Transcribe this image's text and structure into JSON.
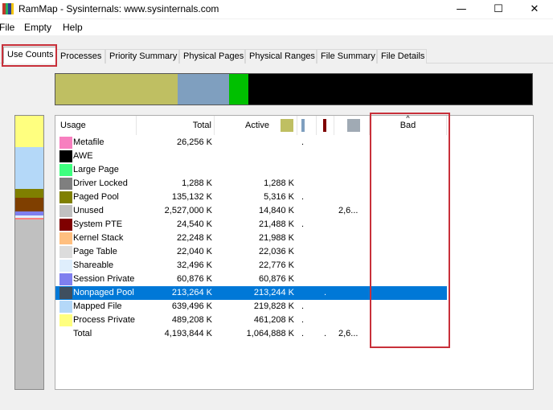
{
  "window": {
    "title": "RamMap - Sysinternals: www.sysinternals.com",
    "minimize": "—",
    "maximize": "☐",
    "close": "✕"
  },
  "menu": {
    "file": "File",
    "empty": "Empty",
    "help": "Help"
  },
  "tabs": {
    "use_counts": "Use Counts",
    "processes": "Processes",
    "priority_summary": "Priority Summary",
    "physical_pages": "Physical Pages",
    "physical_ranges": "Physical Ranges",
    "file_summary": "File Summary",
    "file_details": "File Details"
  },
  "columns": {
    "usage": "Usage",
    "total": "Total",
    "active": "Active",
    "bad": "Bad",
    "sort_indicator": "^"
  },
  "colors": {
    "accent_outline": "#c8303a",
    "selection": "#0078d7",
    "active_swatch": "#bfbf62",
    "standby_swatch": "#7f9fbf",
    "modified_swatch": "#7f0000",
    "transition_swatch": "#a0aab4"
  },
  "rows": [
    {
      "name": "Metafile",
      "total": "26,256 K",
      "active": "",
      "c1": ".",
      "c2": "",
      "c3": "",
      "color": "#f77fbf"
    },
    {
      "name": "AWE",
      "total": "",
      "active": "",
      "c1": "",
      "c2": "",
      "c3": "",
      "color": "#000000"
    },
    {
      "name": "Large Page",
      "total": "",
      "active": "",
      "c1": "",
      "c2": "",
      "c3": "",
      "color": "#3fff7f"
    },
    {
      "name": "Driver Locked",
      "total": "1,288 K",
      "active": "1,288 K",
      "c1": "",
      "c2": "",
      "c3": "",
      "color": "#7f7f7f"
    },
    {
      "name": "Paged Pool",
      "total": "135,132 K",
      "active": "5,316 K",
      "c1": ".",
      "c2": "",
      "c3": "",
      "color": "#7f7f00"
    },
    {
      "name": "Unused",
      "total": "2,527,000 K",
      "active": "14,840 K",
      "c1": "",
      "c2": "",
      "c3": "2,6...",
      "color": "#c0c0c0"
    },
    {
      "name": "System PTE",
      "total": "24,540 K",
      "active": "21,488 K",
      "c1": ".",
      "c2": "",
      "c3": "",
      "color": "#7f0000"
    },
    {
      "name": "Kernel Stack",
      "total": "22,248 K",
      "active": "21,988 K",
      "c1": "",
      "c2": "",
      "c3": "",
      "color": "#ffbf7f"
    },
    {
      "name": "Page Table",
      "total": "22,040 K",
      "active": "22,036 K",
      "c1": "",
      "c2": "",
      "c3": "",
      "color": "#dcdcdc"
    },
    {
      "name": "Shareable",
      "total": "32,496 K",
      "active": "22,776 K",
      "c1": "",
      "c2": "",
      "c3": "",
      "color": "#dfeefc"
    },
    {
      "name": "Session Private",
      "total": "60,876 K",
      "active": "60,876 K",
      "c1": "",
      "c2": "",
      "c3": "",
      "color": "#7f7fef"
    },
    {
      "name": "Nonpaged Pool",
      "total": "213,264 K",
      "active": "213,244 K",
      "c1": "",
      "c2": ".",
      "c3": "",
      "color": "#3f4f5f",
      "selected": true
    },
    {
      "name": "Mapped File",
      "total": "639,496 K",
      "active": "219,828 K",
      "c1": ".",
      "c2": "",
      "c3": "",
      "color": "#b4d8f8"
    },
    {
      "name": "Process Private",
      "total": "489,208 K",
      "active": "461,208 K",
      "c1": ".",
      "c2": "",
      "c3": "",
      "color": "#ffff7f"
    },
    {
      "name": "Total",
      "total": "4,193,844 K",
      "active": "1,064,888 K",
      "c1": ".",
      "c2": ".",
      "c3": "2,6...",
      "color": ""
    }
  ],
  "usage_bar": [
    {
      "name": "active",
      "color": "#bfbf62",
      "fraction": 0.256
    },
    {
      "name": "standby",
      "color": "#7f9fbf",
      "fraction": 0.108
    },
    {
      "name": "modified",
      "color": "#00c000",
      "fraction": 0.04
    },
    {
      "name": "free",
      "color": "#000000",
      "fraction": 0.596
    }
  ],
  "allocation_bar": [
    {
      "name": "Process Private",
      "color": "#ffff7f",
      "fraction": 0.116
    },
    {
      "name": "Mapped File",
      "color": "#b4d8f8",
      "fraction": 0.152
    },
    {
      "name": "Paged Pool",
      "color": "#7f7f00",
      "fraction": 0.032
    },
    {
      "name": "Nonpaged Pool",
      "color": "#7f3f00",
      "fraction": 0.051
    },
    {
      "name": "Session Private",
      "color": "#7f7fef",
      "fraction": 0.015
    },
    {
      "name": "Shareable",
      "color": "#dfeefc",
      "fraction": 0.008
    },
    {
      "name": "System PTE",
      "color": "#ff7f7f",
      "fraction": 0.006
    },
    {
      "name": "Unused",
      "color": "#c0c0c0",
      "fraction": 0.622
    }
  ]
}
